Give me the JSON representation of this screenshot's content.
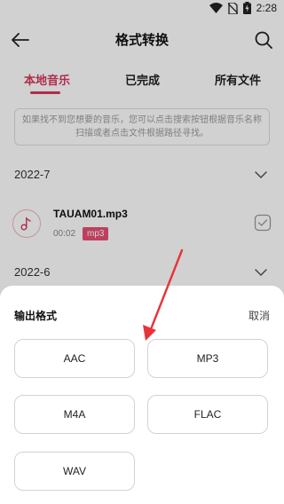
{
  "status_bar": {
    "time": "2:28"
  },
  "header": {
    "title": "格式转换"
  },
  "tabs": [
    {
      "label": "本地音乐",
      "active": true
    },
    {
      "label": "已完成",
      "active": false
    },
    {
      "label": "所有文件",
      "active": false
    }
  ],
  "hint": {
    "text": "如果找不到您想要的音乐，您可以点击搜索按钮根据音乐名称扫描或者点击文件根据路径寻找。"
  },
  "groups": [
    {
      "label": "2022-7",
      "files": [
        {
          "name": "TAUAM01.mp3",
          "duration": "00:02",
          "format": "mp3"
        }
      ]
    },
    {
      "label": "2022-6",
      "files": []
    }
  ],
  "sheet": {
    "title": "输出格式",
    "cancel_label": "取消",
    "formats": [
      "AAC",
      "MP3",
      "M4A",
      "FLAC",
      "WAV"
    ]
  },
  "colors": {
    "accent": "#d6385c",
    "badge": "#e84f74",
    "arrow": "#e8333a"
  }
}
